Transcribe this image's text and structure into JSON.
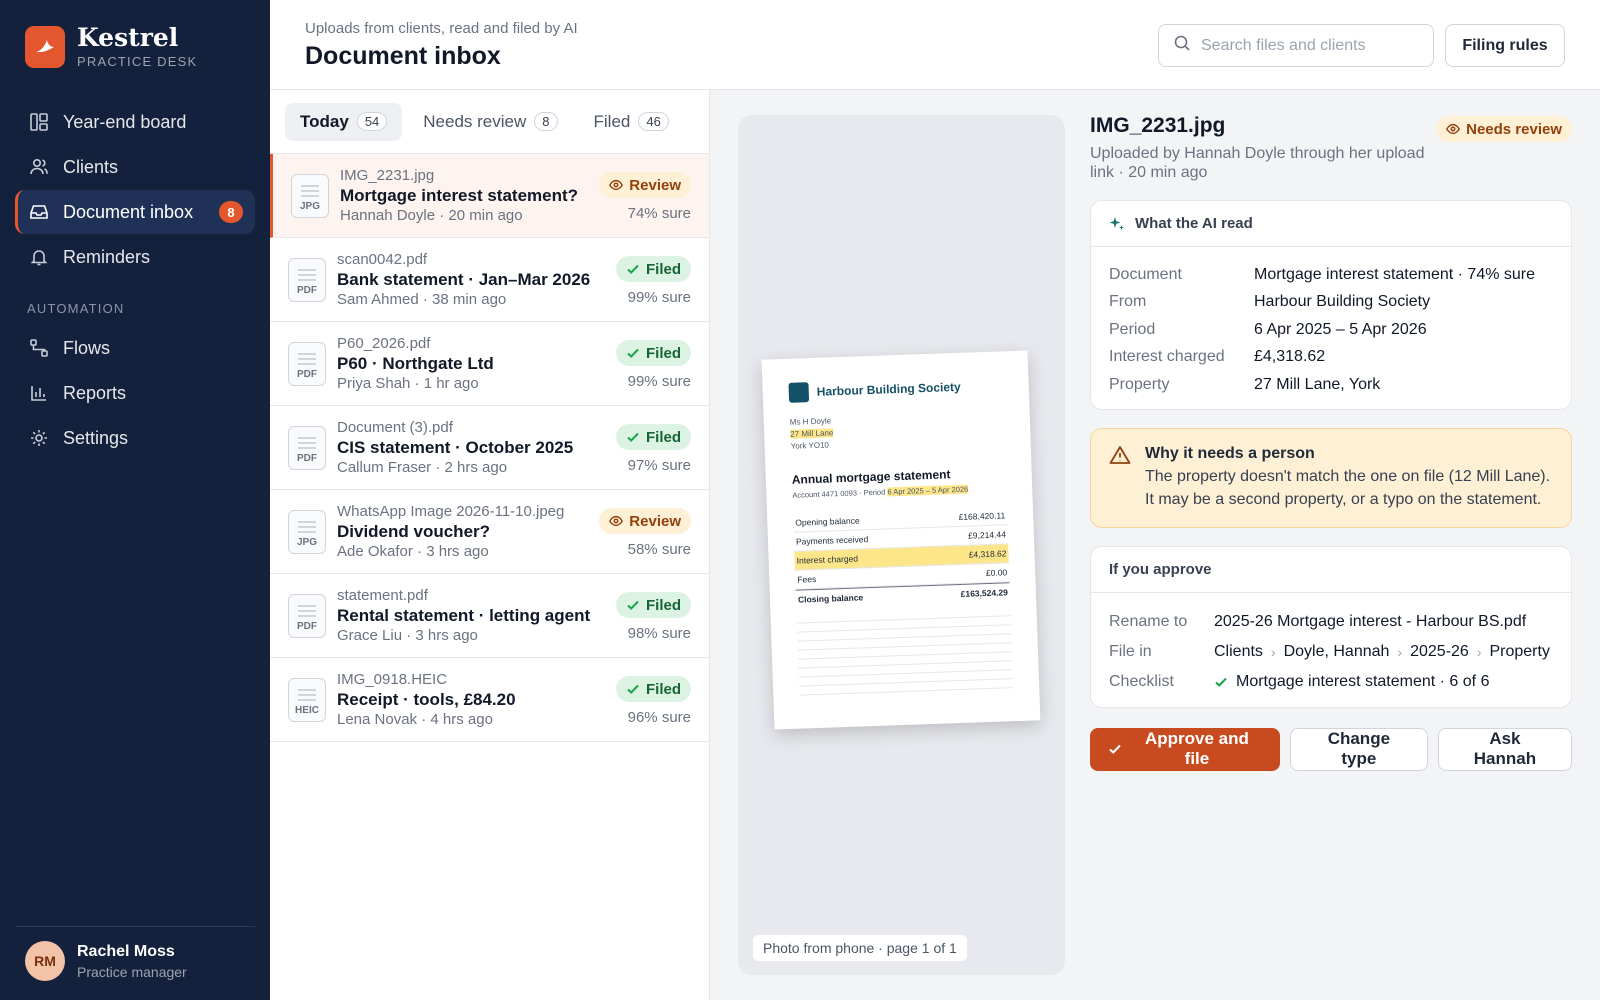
{
  "brand": {
    "name": "Kestrel",
    "subtitle": "PRACTICE DESK",
    "accent": "#e4572e"
  },
  "nav": {
    "items": [
      {
        "label": "Year-end board",
        "icon": "board-icon"
      },
      {
        "label": "Clients",
        "icon": "users-icon"
      },
      {
        "label": "Document inbox",
        "icon": "inbox-icon",
        "badge": "8",
        "active": true
      },
      {
        "label": "Reminders",
        "icon": "bell-icon"
      }
    ],
    "section_label": "AUTOMATION",
    "automation": [
      {
        "label": "Flows",
        "icon": "flow-icon"
      },
      {
        "label": "Reports",
        "icon": "bar-chart-icon"
      },
      {
        "label": "Settings",
        "icon": "gear-icon"
      }
    ]
  },
  "user": {
    "initials": "RM",
    "name": "Rachel Moss",
    "role": "Practice manager"
  },
  "header": {
    "subtitle": "Uploads from clients, read and filed by AI",
    "title": "Document inbox",
    "search_placeholder": "Search files and clients",
    "filing_rules_label": "Filing rules"
  },
  "tabs": [
    {
      "label": "Today",
      "count": "54",
      "active": true
    },
    {
      "label": "Needs review",
      "count": "8"
    },
    {
      "label": "Filed",
      "count": "46"
    }
  ],
  "documents": [
    {
      "file": "IMG_2231.jpg",
      "title": "Mortgage interest statement?",
      "meta": "Hannah Doyle · 20 min ago",
      "ext": "JPG",
      "status": "Review",
      "status_type": "review",
      "confidence": "74% sure",
      "selected": true
    },
    {
      "file": "scan0042.pdf",
      "title": "Bank statement · Jan–Mar 2026",
      "meta": "Sam Ahmed · 38 min ago",
      "ext": "PDF",
      "status": "Filed",
      "status_type": "filed",
      "confidence": "99% sure"
    },
    {
      "file": "P60_2026.pdf",
      "title": "P60 · Northgate Ltd",
      "meta": "Priya Shah · 1 hr ago",
      "ext": "PDF",
      "status": "Filed",
      "status_type": "filed",
      "confidence": "99% sure"
    },
    {
      "file": "Document (3).pdf",
      "title": "CIS statement · October 2025",
      "meta": "Callum Fraser · 2 hrs ago",
      "ext": "PDF",
      "status": "Filed",
      "status_type": "filed",
      "confidence": "97% sure"
    },
    {
      "file": "WhatsApp Image 2026-11-10.jpeg",
      "title": "Dividend voucher?",
      "meta": "Ade Okafor · 3 hrs ago",
      "ext": "JPG",
      "status": "Review",
      "status_type": "review",
      "confidence": "58% sure"
    },
    {
      "file": "statement.pdf",
      "title": "Rental statement · letting agent",
      "meta": "Grace Liu · 3 hrs ago",
      "ext": "PDF",
      "status": "Filed",
      "status_type": "filed",
      "confidence": "98% sure"
    },
    {
      "file": "IMG_0918.HEIC",
      "title": "Receipt · tools, £84.20",
      "meta": "Lena Novak · 4 hrs ago",
      "ext": "HEIC",
      "status": "Filed",
      "status_type": "filed",
      "confidence": "96% sure"
    }
  ],
  "preview": {
    "bank": "Harbour Building Society",
    "addr_name": "Ms H Doyle",
    "addr_street": "27 Mill Lane",
    "addr_city": "York YO10",
    "doc_title": "Annual mortgage statement",
    "acct_prefix": "Account 4471 0093 · Period ",
    "acct_period": "6 Apr 2025 – 5 Apr 2026",
    "rows": [
      {
        "label": "Opening balance",
        "value": "£168,420.11"
      },
      {
        "label": "Payments received",
        "value": "£9,214.44"
      },
      {
        "label": "Interest charged",
        "value": "£4,318.62",
        "highlight": true
      },
      {
        "label": "Fees",
        "value": "£0.00"
      },
      {
        "label": "Closing balance",
        "value": "£163,524.29",
        "bold": true
      }
    ],
    "caption": "Photo from phone · page 1 of 1"
  },
  "detail": {
    "title": "IMG_2231.jpg",
    "status": "Needs review",
    "subtitle": "Uploaded by Hannah Doyle through her upload link · 20 min ago",
    "ai_heading": "What the AI read",
    "fields": [
      {
        "k": "Document",
        "v": "Mortgage interest statement · 74% sure"
      },
      {
        "k": "From",
        "v": "Harbour Building Society"
      },
      {
        "k": "Period",
        "v": "6 Apr 2025 – 5 Apr 2026"
      },
      {
        "k": "Interest charged",
        "v": "£4,318.62"
      },
      {
        "k": "Property",
        "v": "27 Mill Lane, York"
      }
    ],
    "warn_title": "Why it needs a person",
    "warn_body": "The property doesn't match the one on file (12 Mill Lane). It may be a second property, or a typo on the statement.",
    "approve_heading": "If you approve",
    "rename_label": "Rename to",
    "rename_value": "2025-26 Mortgage interest - Harbour BS.pdf",
    "filein_label": "File in",
    "filein_path": [
      "Clients",
      "Doyle, Hannah",
      "2025-26",
      "Property"
    ],
    "checklist_label": "Checklist",
    "checklist_value": "Mortgage interest statement · 6 of 6",
    "approve_btn": "Approve and file",
    "change_btn": "Change type",
    "ask_btn": "Ask Hannah"
  }
}
